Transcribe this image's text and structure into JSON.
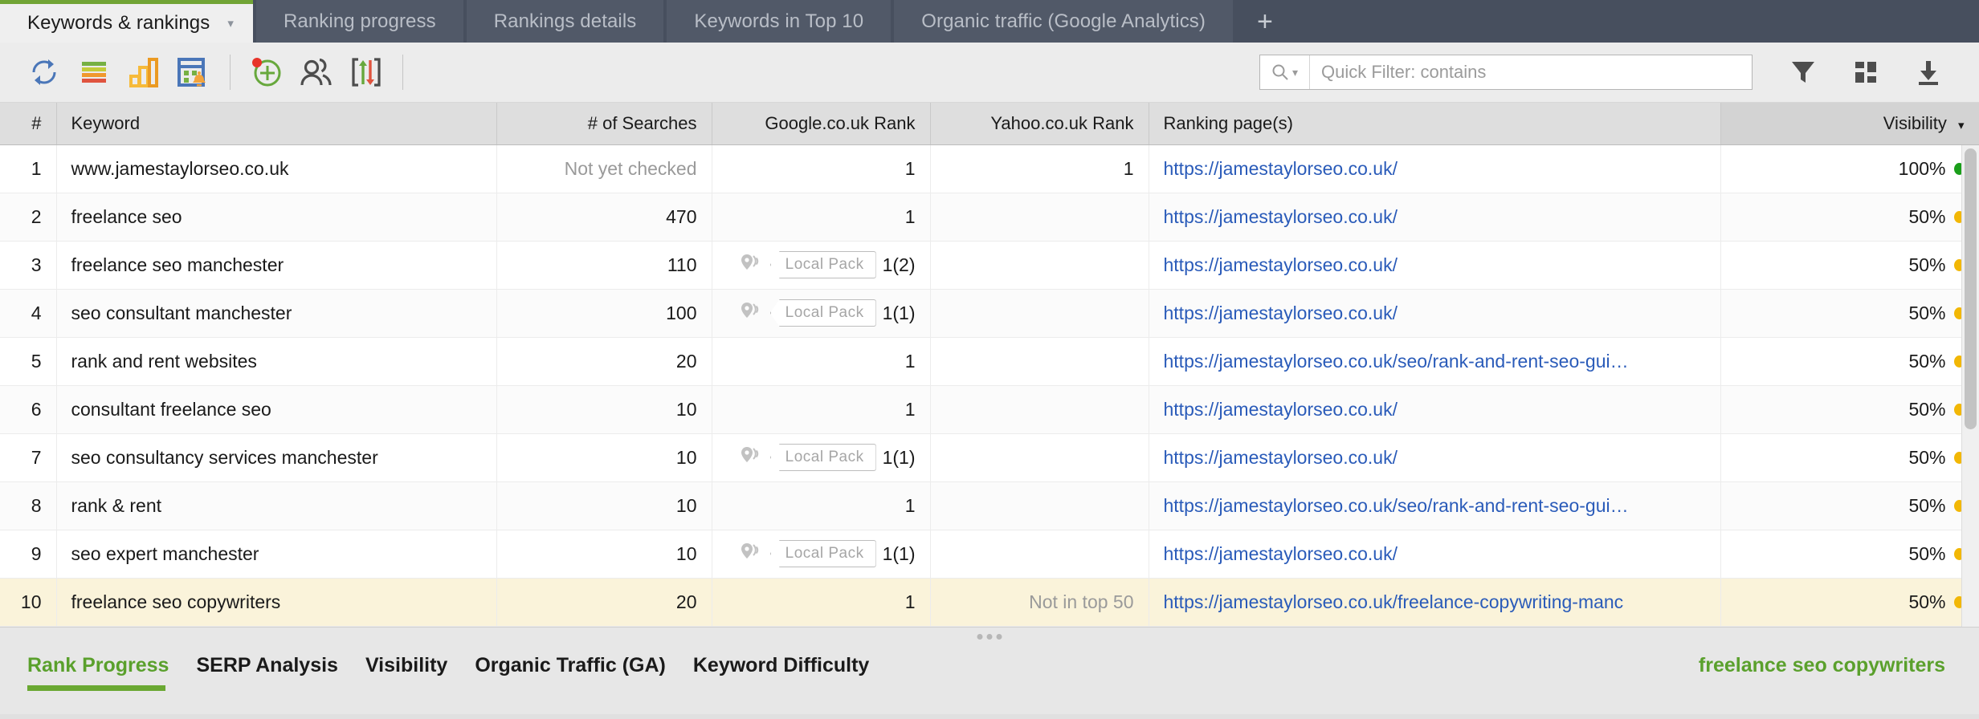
{
  "window": {
    "accent_green": "#6aa832",
    "tabbar_bg": "#474f5e"
  },
  "tabs": [
    {
      "label": "Keywords & rankings",
      "active": true,
      "caret": "▾"
    },
    {
      "label": "Ranking progress",
      "active": false
    },
    {
      "label": "Rankings details",
      "active": false
    },
    {
      "label": "Keywords in Top 10",
      "active": false
    },
    {
      "label": "Organic traffic (Google Analytics)",
      "active": false
    }
  ],
  "tab_add_label": "+",
  "toolbar": {
    "icons": [
      {
        "name": "refresh-icon",
        "title": "Check rankings"
      },
      {
        "name": "colored-bars-icon",
        "title": "Keyword groups"
      },
      {
        "name": "bar-chart-icon",
        "title": "Statistics"
      },
      {
        "name": "calendar-alert-icon",
        "title": "Scheduled tasks"
      },
      {
        "name": "add-keyword-icon",
        "title": "Add keywords"
      },
      {
        "name": "competitors-icon",
        "title": "Competitors"
      },
      {
        "name": "import-export-icon",
        "title": "Import / export"
      }
    ],
    "right_icons": [
      {
        "name": "filter-funnel-icon",
        "title": "Filter"
      },
      {
        "name": "grid-layout-icon",
        "title": "Column layout"
      },
      {
        "name": "download-icon",
        "title": "Export"
      }
    ]
  },
  "search": {
    "mode_icon": "search-icon",
    "mode_caret": "▾",
    "value": "",
    "placeholder": "Quick Filter: contains"
  },
  "table": {
    "columns": [
      {
        "key": "num",
        "label": "#",
        "align": "right",
        "sorted": false
      },
      {
        "key": "kw",
        "label": "Keyword",
        "align": "left",
        "sorted": false
      },
      {
        "key": "srch",
        "label": "# of Searches",
        "align": "right",
        "sorted": false
      },
      {
        "key": "grank",
        "label": "Google.co.uk Rank",
        "align": "right",
        "sorted": false
      },
      {
        "key": "yrank",
        "label": "Yahoo.co.uk Rank",
        "align": "right",
        "sorted": false
      },
      {
        "key": "page",
        "label": "Ranking page(s)",
        "align": "left",
        "sorted": false
      },
      {
        "key": "vis",
        "label": "Visibility",
        "align": "right",
        "sorted": true,
        "sort_caret": "▾"
      }
    ],
    "badge_label": "Local Pack",
    "rows": [
      {
        "num": "1",
        "kw": "www.jamestaylorseo.co.uk",
        "srch": "Not yet checked",
        "srch_muted": true,
        "grank": "1",
        "glocal": false,
        "yrank": "1",
        "page": "https://jamestaylorseo.co.uk/",
        "vis": "100%",
        "dot": "#1a9e1a",
        "selected": false
      },
      {
        "num": "2",
        "kw": "freelance seo",
        "srch": "470",
        "srch_muted": false,
        "grank": "1",
        "glocal": false,
        "yrank": "",
        "page": "https://jamestaylorseo.co.uk/",
        "vis": "50%",
        "dot": "#f2b705",
        "selected": false
      },
      {
        "num": "3",
        "kw": "freelance seo manchester",
        "srch": "110",
        "srch_muted": false,
        "grank": "1(2)",
        "glocal": true,
        "yrank": "",
        "page": "https://jamestaylorseo.co.uk/",
        "vis": "50%",
        "dot": "#f2b705",
        "selected": false
      },
      {
        "num": "4",
        "kw": "seo consultant manchester",
        "srch": "100",
        "srch_muted": false,
        "grank": "1(1)",
        "glocal": true,
        "yrank": "",
        "page": "https://jamestaylorseo.co.uk/",
        "vis": "50%",
        "dot": "#f2b705",
        "selected": false
      },
      {
        "num": "5",
        "kw": "rank and rent websites",
        "srch": "20",
        "srch_muted": false,
        "grank": "1",
        "glocal": false,
        "yrank": "",
        "page": "https://jamestaylorseo.co.uk/seo/rank-and-rent-seo-gui…",
        "vis": "50%",
        "dot": "#f2b705",
        "selected": false
      },
      {
        "num": "6",
        "kw": "consultant freelance seo",
        "srch": "10",
        "srch_muted": false,
        "grank": "1",
        "glocal": false,
        "yrank": "",
        "page": "https://jamestaylorseo.co.uk/",
        "vis": "50%",
        "dot": "#f2b705",
        "selected": false
      },
      {
        "num": "7",
        "kw": "seo consultancy services manchester",
        "srch": "10",
        "srch_muted": false,
        "grank": "1(1)",
        "glocal": true,
        "yrank": "",
        "page": "https://jamestaylorseo.co.uk/",
        "vis": "50%",
        "dot": "#f2b705",
        "selected": false
      },
      {
        "num": "8",
        "kw": "rank & rent",
        "srch": "10",
        "srch_muted": false,
        "grank": "1",
        "glocal": false,
        "yrank": "",
        "page": "https://jamestaylorseo.co.uk/seo/rank-and-rent-seo-gui…",
        "vis": "50%",
        "dot": "#f2b705",
        "selected": false
      },
      {
        "num": "9",
        "kw": "seo expert manchester",
        "srch": "10",
        "srch_muted": false,
        "grank": "1(1)",
        "glocal": true,
        "yrank": "",
        "page": "https://jamestaylorseo.co.uk/",
        "vis": "50%",
        "dot": "#f2b705",
        "selected": false
      },
      {
        "num": "10",
        "kw": "freelance seo copywriters",
        "srch": "20",
        "srch_muted": false,
        "grank": "1",
        "glocal": false,
        "yrank": "Not in top 50",
        "page": "https://jamestaylorseo.co.uk/freelance-copywriting-manc",
        "vis": "50%",
        "dot": "#f2b705",
        "selected": true
      }
    ]
  },
  "bottom_panel": {
    "tabs": [
      {
        "label": "Rank Progress",
        "active": true
      },
      {
        "label": "SERP Analysis",
        "active": false
      },
      {
        "label": "Visibility",
        "active": false
      },
      {
        "label": "Organic Traffic (GA)",
        "active": false
      },
      {
        "label": "Keyword Difficulty",
        "active": false
      }
    ],
    "selected_keyword": "freelance seo copywriters"
  }
}
